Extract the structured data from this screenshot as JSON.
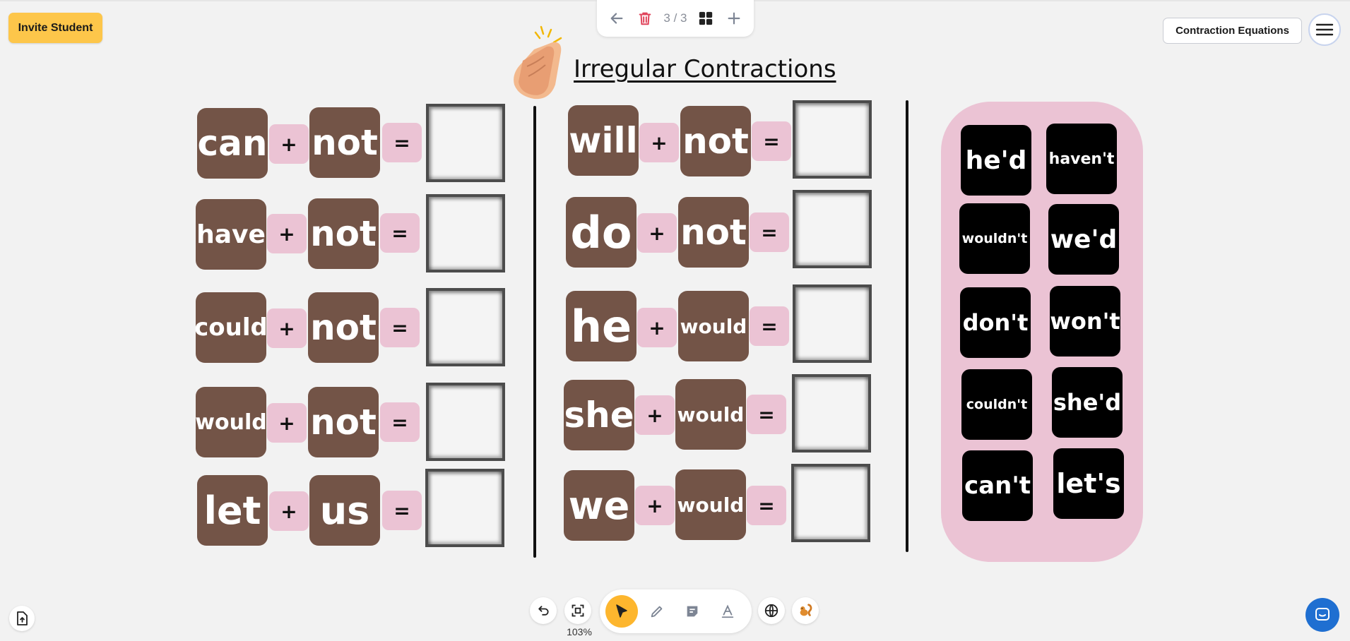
{
  "header": {
    "invite_label": "Invite Student",
    "page_counter": "3 / 3",
    "lesson_title": "Contraction Equations"
  },
  "board": {
    "title": "Irregular Contractions",
    "plus": "+",
    "equals": "=",
    "left_equations": [
      {
        "first": "can",
        "second": "not"
      },
      {
        "first": "have",
        "second": "not"
      },
      {
        "first": "could",
        "second": "not"
      },
      {
        "first": "would",
        "second": "not"
      },
      {
        "first": "let",
        "second": "us"
      }
    ],
    "middle_equations": [
      {
        "first": "will",
        "second": "not"
      },
      {
        "first": "do",
        "second": "not"
      },
      {
        "first": "he",
        "second": "would"
      },
      {
        "first": "she",
        "second": "would"
      },
      {
        "first": "we",
        "second": "would"
      }
    ],
    "answer_bank": [
      "he'd",
      "haven't",
      "wouldn't",
      "we'd",
      "don't",
      "won't",
      "couldn't",
      "she'd",
      "can't",
      "let's"
    ]
  },
  "footer": {
    "zoom": "103%"
  },
  "icons": {
    "back": "arrow-left-icon",
    "delete": "trash-icon",
    "grid": "grid-icon",
    "add": "plus-icon",
    "menu": "hamburger-icon",
    "undo": "undo-icon",
    "fit": "fit-screen-icon",
    "select": "cursor-icon",
    "pen": "pencil-icon",
    "note": "sticky-note-icon",
    "text": "text-icon",
    "globe": "globe-icon",
    "squirrel": "squirrel-icon",
    "upload": "upload-file-icon",
    "chat": "chat-icon"
  },
  "colors": {
    "tile": "#735447",
    "operator": "#ebc3d4",
    "bank": "#ebc3d4",
    "chip": "#000000",
    "invite": "#fdc64a",
    "active_tool": "#fdb62e",
    "delete": "#e0445b",
    "chat": "#1f6fd1"
  }
}
